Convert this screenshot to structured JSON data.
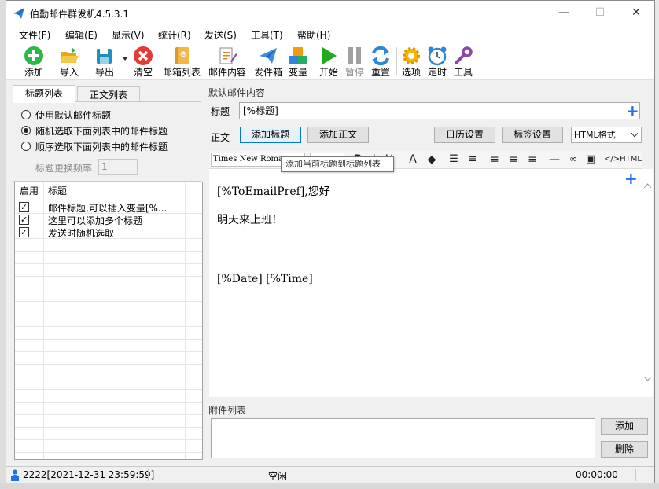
{
  "window": {
    "title": "伯勤邮件群发机4.5.3.1",
    "minimize": "—",
    "maximize": "☐",
    "close": "✕"
  },
  "menu": [
    "文件(F)",
    "编辑(E)",
    "显示(V)",
    "统计(R)",
    "发送(S)",
    "工具(T)",
    "帮助(H)"
  ],
  "toolbar": {
    "add": "添加",
    "import": "导入",
    "export": "导出",
    "clear": "清空",
    "mailbox_list": "邮箱列表",
    "mail_content": "邮件内容",
    "outbox": "发件箱",
    "variables": "变量",
    "start": "开始",
    "pause": "暂停",
    "reset": "重置",
    "options": "选项",
    "timer": "定时",
    "tools": "工具"
  },
  "left": {
    "tabs": [
      "标题列表",
      "正文列表"
    ],
    "radio_default": "使用默认邮件标题",
    "radio_random": "随机选取下面列表中的邮件标题",
    "radio_sequential": "顺序选取下面列表中的邮件标题",
    "freq_label": "标题更换频率",
    "freq_value": "1",
    "grid_headers": [
      "启用",
      "标题"
    ],
    "rows": [
      {
        "checked": true,
        "text": "邮件标题,可以插入变量[%..."
      },
      {
        "checked": true,
        "text": "这里可以添加多个标题"
      },
      {
        "checked": true,
        "text": "发送时随机选取"
      }
    ]
  },
  "right": {
    "group_label": "默认邮件内容",
    "subject_label": "标题",
    "subject_value": "[%标题]",
    "body_label": "正文",
    "btn_add_subject": "添加标题",
    "btn_add_body": "添加正文",
    "btn_calendar": "日历设置",
    "btn_tags": "标签设置",
    "format": "HTML格式",
    "font": "Times New Roman",
    "tooltip": "添加当前标题到标题列表",
    "html_btn": "</>HTML",
    "body_lines": [
      "[%ToEmailPref],您好",
      "明天来上班!",
      "[%Date] [%Time]"
    ],
    "attach_label": "附件列表",
    "attach_add": "添加",
    "attach_delete": "删除"
  },
  "status": {
    "user": "2222[2021-12-31 23:59:59]",
    "state": "空闲",
    "time": "00:00:00"
  },
  "colors": {
    "accent": "#1a73e8",
    "add_green": "#2db84a",
    "clear_red": "#e53935",
    "start_green": "#22aa22"
  }
}
